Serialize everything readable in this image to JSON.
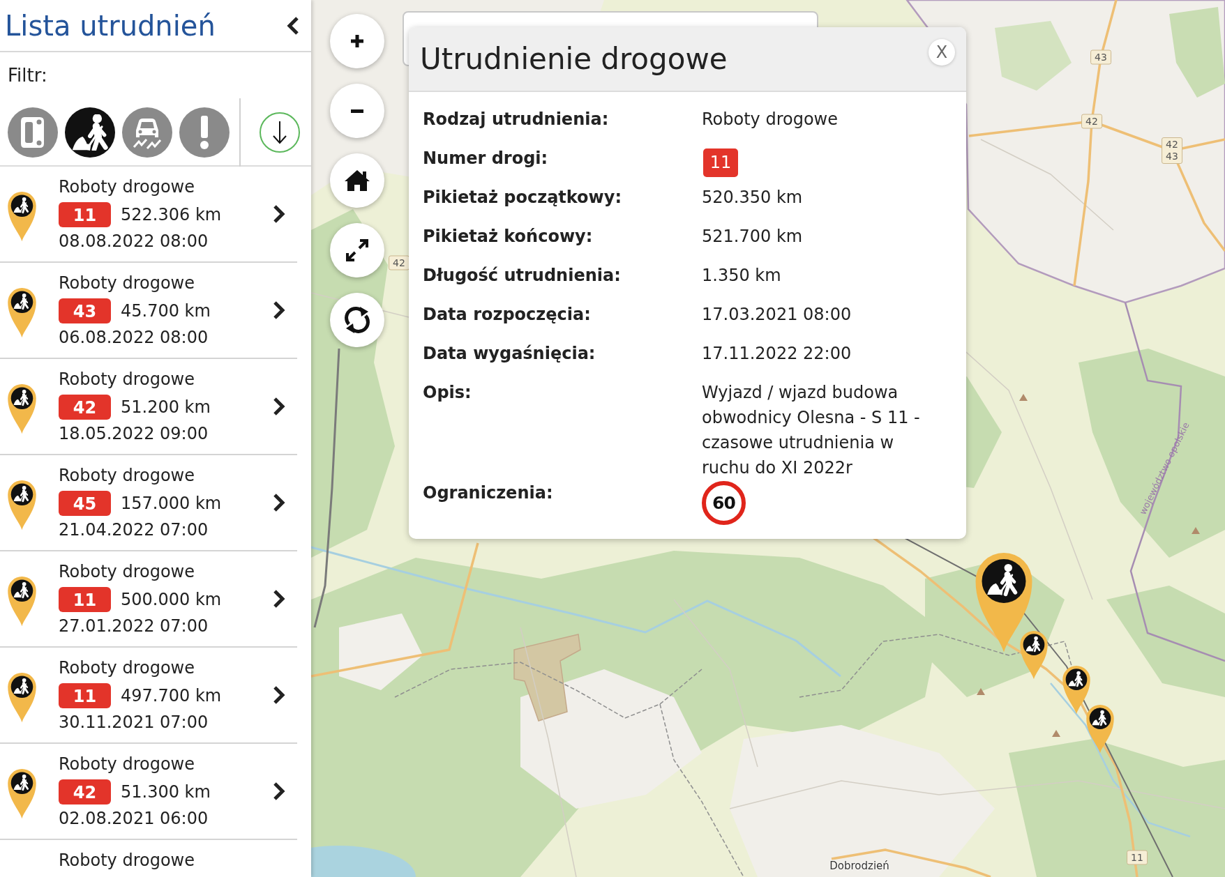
{
  "sidebar": {
    "title": "Lista utrudnień",
    "filter_label": "Filtr:",
    "filters": [
      {
        "kind": "accident",
        "selected": false
      },
      {
        "kind": "roadworks",
        "selected": true
      },
      {
        "kind": "slippery",
        "selected": false
      },
      {
        "kind": "warning",
        "selected": false
      }
    ],
    "items": [
      {
        "kind": "roadworks",
        "title": "Roboty drogowe",
        "road": "11",
        "distance": "522.306 km",
        "date": "08.08.2022 08:00"
      },
      {
        "kind": "roadworks",
        "title": "Roboty drogowe",
        "road": "43",
        "distance": "45.700 km",
        "date": "06.08.2022 08:00"
      },
      {
        "kind": "roadworks",
        "title": "Roboty drogowe",
        "road": "42",
        "distance": "51.200 km",
        "date": "18.05.2022 09:00"
      },
      {
        "kind": "roadworks",
        "title": "Roboty drogowe",
        "road": "45",
        "distance": "157.000 km",
        "date": "21.04.2022 07:00"
      },
      {
        "kind": "roadworks",
        "title": "Roboty drogowe",
        "road": "11",
        "distance": "500.000 km",
        "date": "27.01.2022 07:00"
      },
      {
        "kind": "roadworks",
        "title": "Roboty drogowe",
        "road": "11",
        "distance": "497.700 km",
        "date": "30.11.2021 07:00"
      },
      {
        "kind": "roadworks",
        "title": "Roboty drogowe",
        "road": "42",
        "distance": "51.300 km",
        "date": "02.08.2021 06:00"
      },
      {
        "title": "Roboty drogowe"
      }
    ]
  },
  "map": {
    "road_signs": [
      {
        "lines": [
          "43"
        ]
      },
      {
        "lines": [
          "42"
        ]
      },
      {
        "lines": [
          "42",
          "43"
        ]
      },
      {
        "lines": [
          "42"
        ]
      },
      {
        "lines": [
          "11"
        ]
      }
    ],
    "place_labels": [
      {
        "kind": "town",
        "text": "Dobrodzień"
      },
      {
        "kind": "region",
        "text": "województwo opolskie"
      }
    ],
    "markers": [
      {
        "kind": "roadworks",
        "selected": true
      },
      {
        "kind": "roadworks",
        "selected": false
      },
      {
        "kind": "roadworks",
        "selected": false
      },
      {
        "kind": "roadworks",
        "selected": false
      }
    ]
  },
  "popup": {
    "title": "Utrudnienie drogowe",
    "close": "X",
    "rows": [
      {
        "kind": "text",
        "label": "Rodzaj utrudnienia:",
        "value": "Roboty drogowe"
      },
      {
        "kind": "road",
        "label": "Numer drogi:",
        "value": "11"
      },
      {
        "kind": "text",
        "label": "Pikietaż początkowy:",
        "value": "520.350 km"
      },
      {
        "kind": "text",
        "label": "Pikietaż końcowy:",
        "value": "521.700 km"
      },
      {
        "kind": "text",
        "label": "Długość utrudnienia:",
        "value": "1.350 km"
      },
      {
        "kind": "text",
        "label": "Data rozpoczęcia:",
        "value": "17.03.2021 08:00"
      },
      {
        "kind": "text",
        "label": "Data wygaśnięcia:",
        "value": "17.11.2022 22:00"
      },
      {
        "kind": "description",
        "label": "Opis:",
        "value": "Wyjazd / wjazd budowa obwodnicy Olesna - S 11 - czasowe utrudnienia w ruchu do XI 2022r"
      },
      {
        "kind": "speed_limit",
        "label": "Ograniczenia:",
        "value": "60"
      }
    ]
  }
}
